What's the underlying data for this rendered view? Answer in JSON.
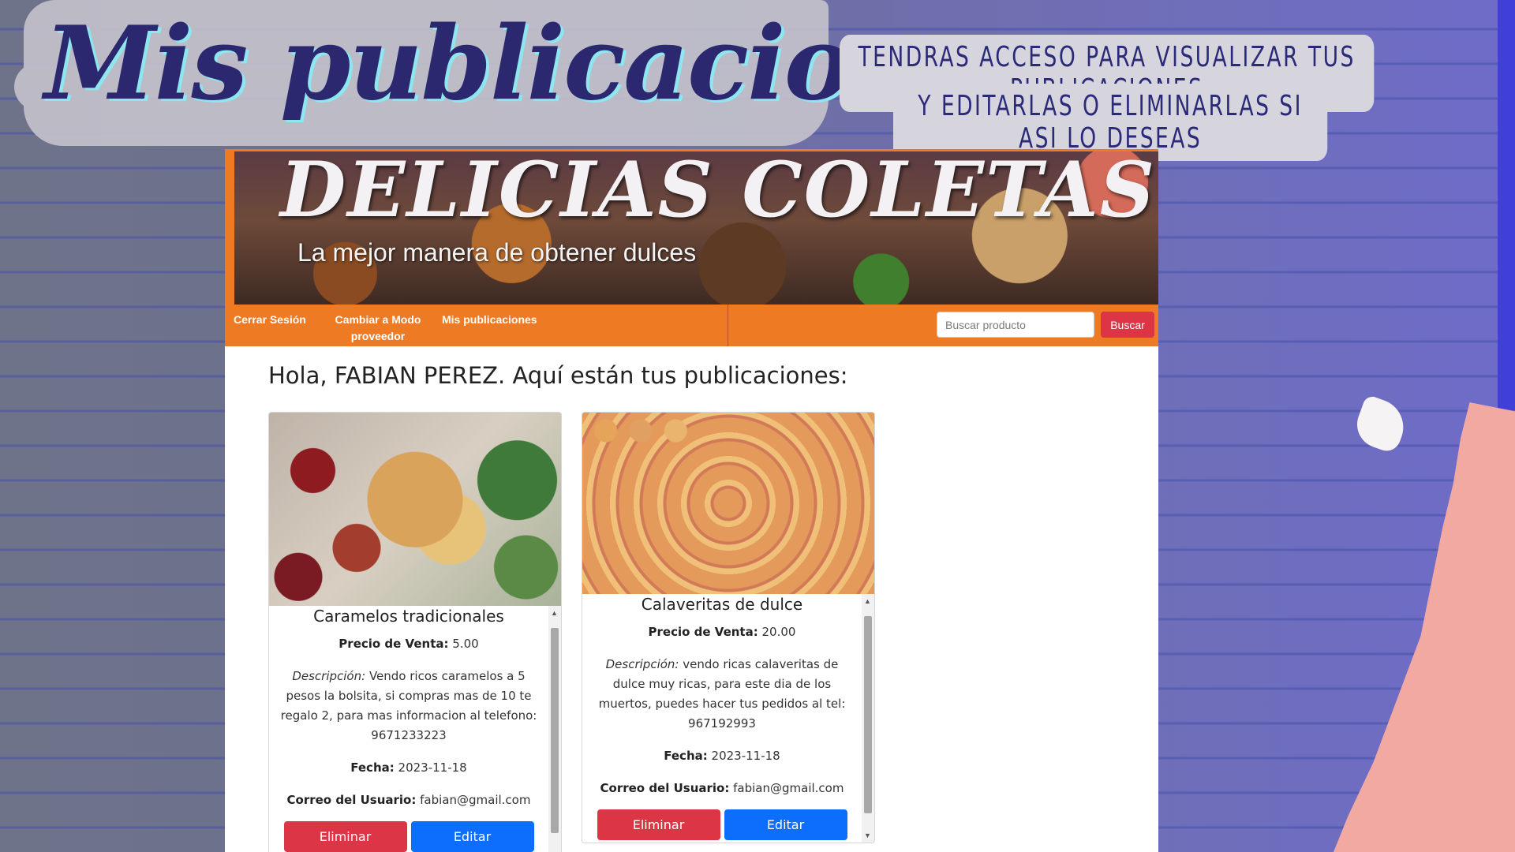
{
  "slide": {
    "title": "Mis publicaciones",
    "subtitle_line1": "TENDRAS ACCESO PARA VISUALIZAR TUS PUBLICACIONES",
    "subtitle_line2": "Y EDITARLAS O ELIMINARLAS SI ASI LO DESEAS"
  },
  "banner": {
    "title": "DELICIAS COLETAS",
    "tagline": "La mejor manera de obtener dulces"
  },
  "nav": {
    "logout": "Cerrar Sesión",
    "switch_mode_line1": "Cambiar a Modo",
    "switch_mode_line2": "proveedor",
    "my_posts": "Mis publicaciones"
  },
  "search": {
    "placeholder": "Buscar producto",
    "button": "Buscar"
  },
  "greeting": "Hola, FABIAN PEREZ. Aquí están tus publicaciones:",
  "labels": {
    "price": "Precio de Venta:",
    "description": "Descripción:",
    "date": "Fecha:",
    "email": "Correo del Usuario:",
    "delete": "Eliminar",
    "edit": "Editar"
  },
  "posts": [
    {
      "title": "Caramelos tradicionales",
      "price": "5.00",
      "description": "Vendo ricos caramelos a 5 pesos la bolsita, si compras mas de 10 te regalo 2, para mas informacion al telefono: 9671233223",
      "date": "2023-11-18",
      "email": "fabian@gmail.com"
    },
    {
      "title": "Calaveritas de dulce",
      "price": "20.00",
      "description": "vendo ricas calaveritas de dulce muy ricas, para este dia de los muertos, puedes hacer tus pedidos al tel: 967192993",
      "date": "2023-11-18",
      "email": "fabian@gmail.com"
    }
  ],
  "colors": {
    "nav_orange": "#ef7a24",
    "danger": "#dc3545",
    "primary": "#0d6efd",
    "title_navy": "#2b2870"
  }
}
